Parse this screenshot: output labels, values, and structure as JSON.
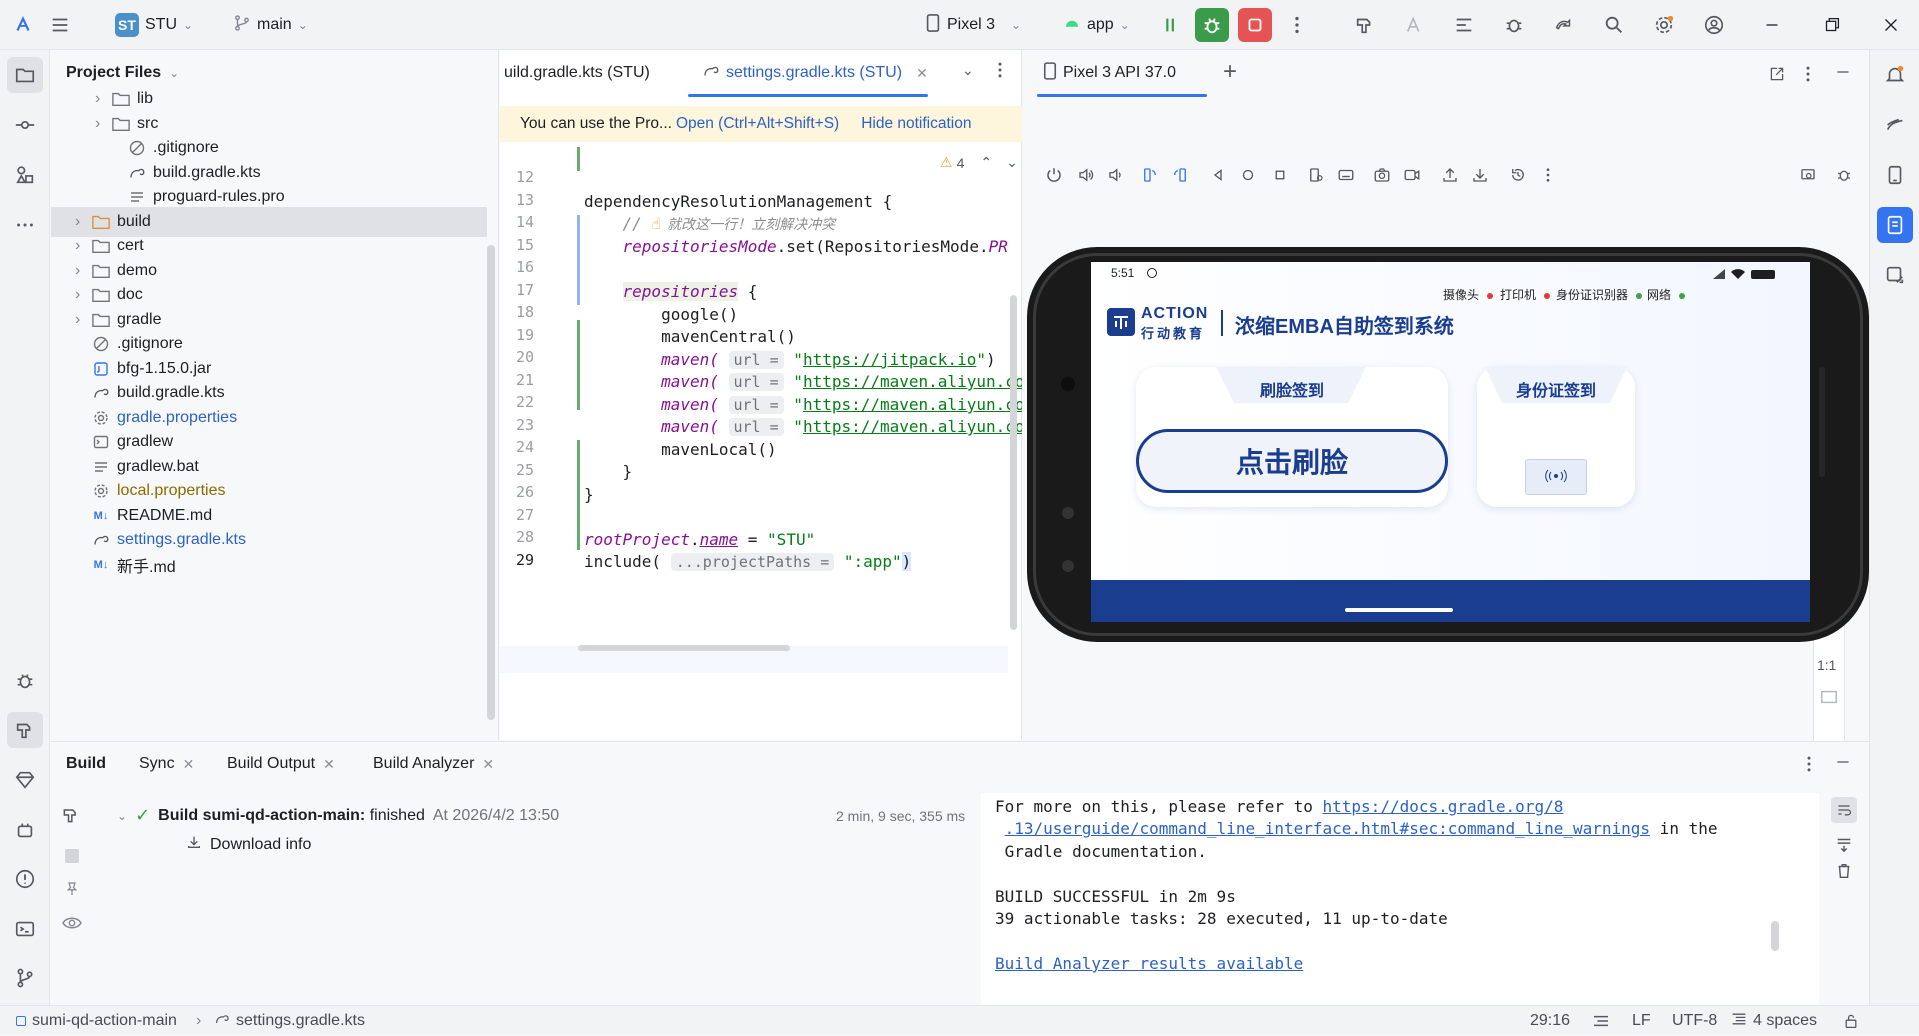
{
  "title_bar": {
    "project_badge": "ST",
    "project_name": "STU",
    "branch": "main",
    "device": "Pixel 3",
    "run_config": "app"
  },
  "project_panel": {
    "header": "Project Files",
    "items": [
      {
        "label": "lib",
        "type": "folder",
        "expandable": true
      },
      {
        "label": "src",
        "type": "folder",
        "expandable": true
      },
      {
        "label": ".gitignore",
        "type": "ignore"
      },
      {
        "label": "build.gradle.kts",
        "type": "gradle"
      },
      {
        "label": "proguard-rules.pro",
        "type": "text"
      },
      {
        "label": "build",
        "type": "folder-orange",
        "expandable": true,
        "selected": true
      },
      {
        "label": "cert",
        "type": "folder",
        "expandable": true
      },
      {
        "label": "demo",
        "type": "folder",
        "expandable": true
      },
      {
        "label": "doc",
        "type": "folder",
        "expandable": true
      },
      {
        "label": "gradle",
        "type": "folder",
        "expandable": true
      },
      {
        "label": ".gitignore",
        "type": "ignore"
      },
      {
        "label": "bfg-1.15.0.jar",
        "type": "jar"
      },
      {
        "label": "build.gradle.kts",
        "type": "gradle"
      },
      {
        "label": "gradle.properties",
        "type": "settings-blue"
      },
      {
        "label": "gradlew",
        "type": "terminal"
      },
      {
        "label": "gradlew.bat",
        "type": "text"
      },
      {
        "label": "local.properties",
        "type": "settings-olive"
      },
      {
        "label": "README.md",
        "type": "md"
      },
      {
        "label": "settings.gradle.kts",
        "type": "gradle-blue"
      },
      {
        "label": "新手.md",
        "type": "md"
      }
    ]
  },
  "editor": {
    "tabs": [
      {
        "label": "uild.gradle.kts (STU)",
        "active": false
      },
      {
        "label": "settings.gradle.kts (STU)",
        "active": true
      }
    ],
    "notification": {
      "text": "You can use the Pro...",
      "action": "Open (Ctrl+Alt+Shift+S)",
      "hide": "Hide notification"
    },
    "warning_count": "4",
    "line_numbers": [
      "12",
      "13",
      "14",
      "15",
      "16",
      "17",
      "18",
      "19",
      "20",
      "21",
      "22",
      "23",
      "24",
      "25",
      "26",
      "27",
      "28",
      "29"
    ],
    "lines": {
      "l13": "dependencyResolutionManagement {",
      "l14_slash": "    // ",
      "l14_comment": "就改这一行！立刻解决冲突",
      "l15_kw": "repositoriesMode",
      "l15_rest": ".set(RepositoriesMode.",
      "l15_tail": "PR",
      "l17_kw": "repositories",
      "l17_rest": " {",
      "l18": "        google()",
      "l19": "        mavenCentral()",
      "maven_kw": "maven(",
      "url_hint": "url =",
      "l20_url": "https://jitpack.io",
      "l21_url": "https://maven.aliyun.com",
      "l22_url": "https://maven.aliyun.com",
      "l23_url": "https://maven.aliyun.com",
      "l24": "        mavenLocal()",
      "l25": "    }",
      "l26": "}",
      "l28_root": "rootProject",
      "l28_dot": ".",
      "l28_name": "name",
      "l28_eq": " = ",
      "l28_val": "\"STU\"",
      "l29_fn": "include(",
      "l29_hint": "...projectPaths =",
      "l29_val": "\":app\"",
      "l29_close": ")"
    }
  },
  "emulator": {
    "tab": "Pixel 3 API 37.0",
    "zoom_label": "1:1",
    "screen": {
      "time": "5:51",
      "status_items": [
        "摄像头",
        "打印机",
        "身份证识别器",
        "网络"
      ],
      "status_colors": [
        "#e53935",
        "#e53935",
        "#43a047",
        "#43a047"
      ],
      "brand_en": "ACTION",
      "brand_cn": "行动教育",
      "app_title": "浓缩EMBA自助签到系统",
      "card_face": "刷脸签到",
      "face_button": "点击刷脸",
      "card_id": "身份证签到"
    }
  },
  "build_panel": {
    "tabs": [
      {
        "label": "Build",
        "active": true,
        "closable": false
      },
      {
        "label": "Sync",
        "active": false,
        "closable": true
      },
      {
        "label": "Build Output",
        "active": false,
        "closable": true
      },
      {
        "label": "Build Analyzer",
        "active": false,
        "closable": true
      }
    ],
    "result_bold": "Build sumi-qd-action-main:",
    "result_status": " finished",
    "result_time": "At 2026/4/2 13:50",
    "duration": "2 min, 9 sec, 355 ms",
    "download_info": "Download info",
    "console": {
      "l1_text": "For more on this, please refer to ",
      "l1_link": "https://docs.gradle.org/8",
      "l2_link": ".13/userguide/command_line_interface.html#sec:command_line_warnings",
      "l2_text": " in the",
      "l3": " Gradle documentation.",
      "l5": "BUILD SUCCESSFUL in 2m 9s",
      "l6": "39 actionable tasks: 28 executed, 11 up-to-date",
      "l8": "Build Analyzer results available"
    }
  },
  "status_bar": {
    "project": "sumi-qd-action-main",
    "file": "settings.gradle.kts",
    "position": "29:16",
    "line_sep": "LF",
    "encoding": "UTF-8",
    "indent": "4 spaces"
  }
}
